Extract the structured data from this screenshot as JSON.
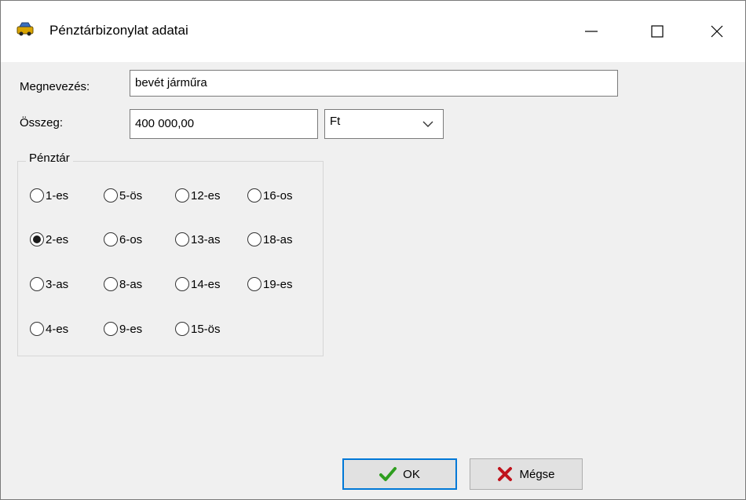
{
  "window": {
    "title": "Pénztárbizonylat adatai",
    "icon": "car-icon"
  },
  "form": {
    "name_label": "Megnevezés:",
    "name_value": "bevét járműra",
    "amount_label": "Összeg:",
    "amount_value": "400 000,00",
    "currency_value": "Ft"
  },
  "cashier_group": {
    "title": "Pénztár",
    "selected": "2-es",
    "options": [
      "1-es",
      "5-ös",
      "12-es",
      "16-os",
      "2-es",
      "6-os",
      "13-as",
      "18-as",
      "3-as",
      "8-as",
      "14-es",
      "19-es",
      "4-es",
      "9-es",
      "15-ös"
    ]
  },
  "buttons": {
    "ok_label": "OK",
    "cancel_label": "Mégse"
  },
  "colors": {
    "focus_border": "#0078d7",
    "ok_check": "#2e9e1f",
    "cancel_x": "#c0141d"
  }
}
